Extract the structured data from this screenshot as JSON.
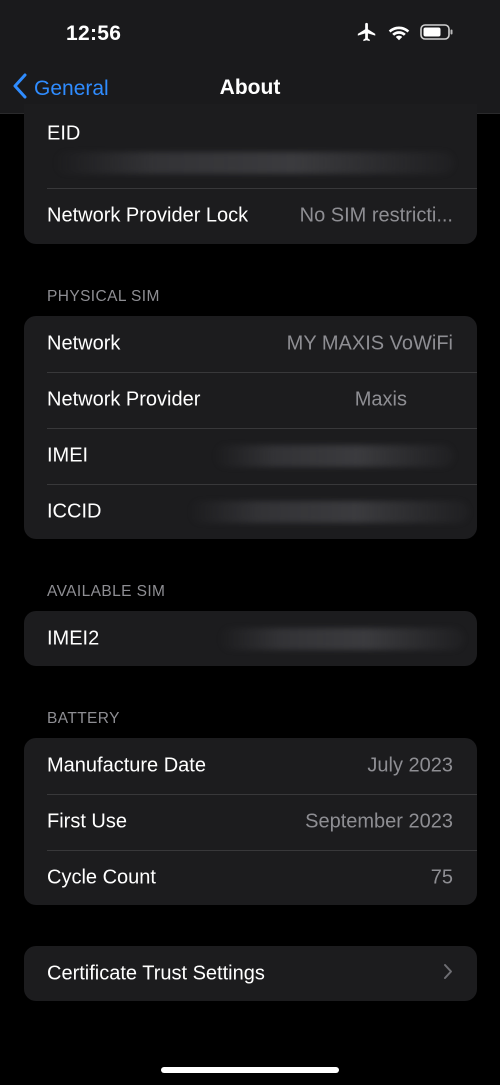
{
  "status_bar": {
    "time": "12:56",
    "icons": [
      "airplane-icon",
      "wifi-icon",
      "battery-icon"
    ]
  },
  "nav": {
    "back_label": "General",
    "title": "About",
    "accent_color": "#2f8cff"
  },
  "top_group": {
    "eid_label": "EID",
    "lock_label": "Network Provider Lock",
    "lock_value": "No SIM restricti..."
  },
  "physical_sim": {
    "header": "PHYSICAL SIM",
    "rows": [
      {
        "label": "Network",
        "value": "MY MAXIS VoWiFi"
      },
      {
        "label": "Network Provider",
        "value": "Maxis"
      },
      {
        "label": "IMEI",
        "value": ""
      },
      {
        "label": "ICCID",
        "value": ""
      }
    ]
  },
  "available_sim": {
    "header": "AVAILABLE SIM",
    "rows": [
      {
        "label": "IMEI2",
        "value": ""
      }
    ]
  },
  "battery": {
    "header": "BATTERY",
    "rows": [
      {
        "label": "Manufacture Date",
        "value": "July 2023"
      },
      {
        "label": "First Use",
        "value": "September 2023"
      },
      {
        "label": "Cycle Count",
        "value": "75"
      }
    ]
  },
  "cert": {
    "label": "Certificate Trust Settings"
  }
}
